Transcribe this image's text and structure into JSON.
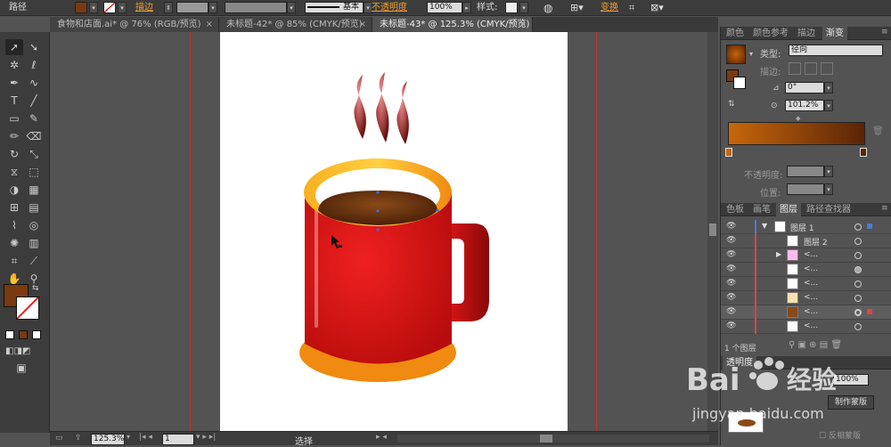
{
  "control_bar": {
    "selection_type": "路径",
    "stroke_label": "描边",
    "stroke_style": "基本",
    "opacity_label": "不透明度",
    "opacity_value": "100%",
    "style_label": "样式",
    "transform_label": "变换",
    "fill_color": "#7a3a10"
  },
  "doc_tabs": [
    {
      "label": "食物和店面.ai* @ 76% (RGB/预览)"
    },
    {
      "label": "未标题-42* @ 85% (CMYK/预览)"
    },
    {
      "label": "未标题-43* @ 125.3% (CMYK/预览)"
    }
  ],
  "status_bar": {
    "zoom": "125.3%",
    "page": "1",
    "tool_name": "选择"
  },
  "gradient_panel": {
    "tabs": [
      "颜色",
      "颜色参考",
      "描边",
      "渐变"
    ],
    "type_label": "类型",
    "type_value": "径向",
    "stroke_label": "描边",
    "angle_value": "0°",
    "ratio_value": "101.2%",
    "opacity_label": "不透明度",
    "position_label": "位置",
    "gradient_start": "#c8660a",
    "gradient_end": "#5a2408"
  },
  "layers_panel": {
    "tabs": [
      "色板",
      "画笔",
      "图层",
      "路径查找器"
    ],
    "layers": [
      {
        "name": "图层 1"
      },
      {
        "name": "图层 2"
      },
      {
        "name": "<..."
      },
      {
        "name": "<..."
      },
      {
        "name": "<..."
      },
      {
        "name": "<..."
      },
      {
        "name": "<..."
      },
      {
        "name": "<..."
      }
    ],
    "count_label": "1 个图层"
  },
  "transparency_panel": {
    "title": "透明度",
    "opacity_value": "100%",
    "make_mask": "制作蒙版",
    "invert_mask": "反相蒙版"
  },
  "watermark": {
    "brand": "Bai",
    "brand_suffix": "经验",
    "url": "jingyan.baidu.com"
  },
  "colors": {
    "mug_red": "#e01818",
    "rim_orange": "#f5a020",
    "coffee": "#6a3410"
  }
}
